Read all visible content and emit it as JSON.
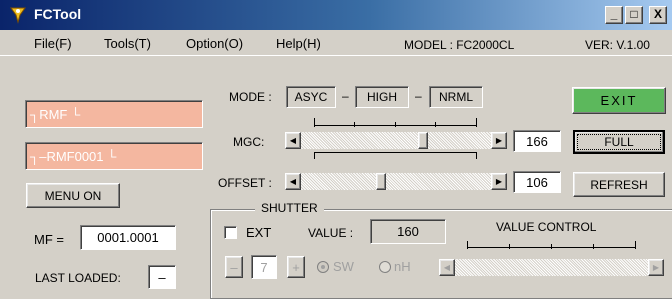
{
  "window": {
    "title": "FCTool",
    "minimize_glyph": "_",
    "maximize_glyph": "□",
    "close_glyph": "X"
  },
  "menu": {
    "items": [
      "File(F)",
      "Tools(T)",
      "Option(O)",
      "Help(H)"
    ],
    "model": "MODEL : FC2000CL",
    "version": "VER: V.1.00"
  },
  "left": {
    "file1": "┐RMF └",
    "file2": "┐–RMF0001 └",
    "menu_button": "MENU ON",
    "mf_label": "MF =",
    "mf_value": "0001.0001",
    "last_loaded_label": "LAST LOADED:",
    "last_loaded_value": "–"
  },
  "mode": {
    "label": "MODE :",
    "values": [
      "ASYC",
      "HIGH",
      "NRML"
    ],
    "separator": "–"
  },
  "mgc": {
    "label": "MGC:",
    "value": "166",
    "level": 166,
    "max": 255
  },
  "offset": {
    "label": "OFFSET :",
    "value": "106",
    "level": 106,
    "max": 255
  },
  "buttons": {
    "exit": "EXIT",
    "full": "FULL",
    "refresh": "REFRESH"
  },
  "shutter": {
    "title": "SHUTTER",
    "ext_label": "EXT",
    "ext_checked": false,
    "value_label": "VALUE :",
    "value": "160",
    "value_control_label": "VALUE CONTROL",
    "minus": "–",
    "step": "7",
    "plus": "+",
    "sw_label": "SW",
    "nh_label": "nH"
  },
  "colors": {
    "exit_bg": "#5cb85c",
    "file_box_bg": "#f4b7a0",
    "titlebar_start": "#0a246a",
    "titlebar_end": "#a6caf0"
  }
}
